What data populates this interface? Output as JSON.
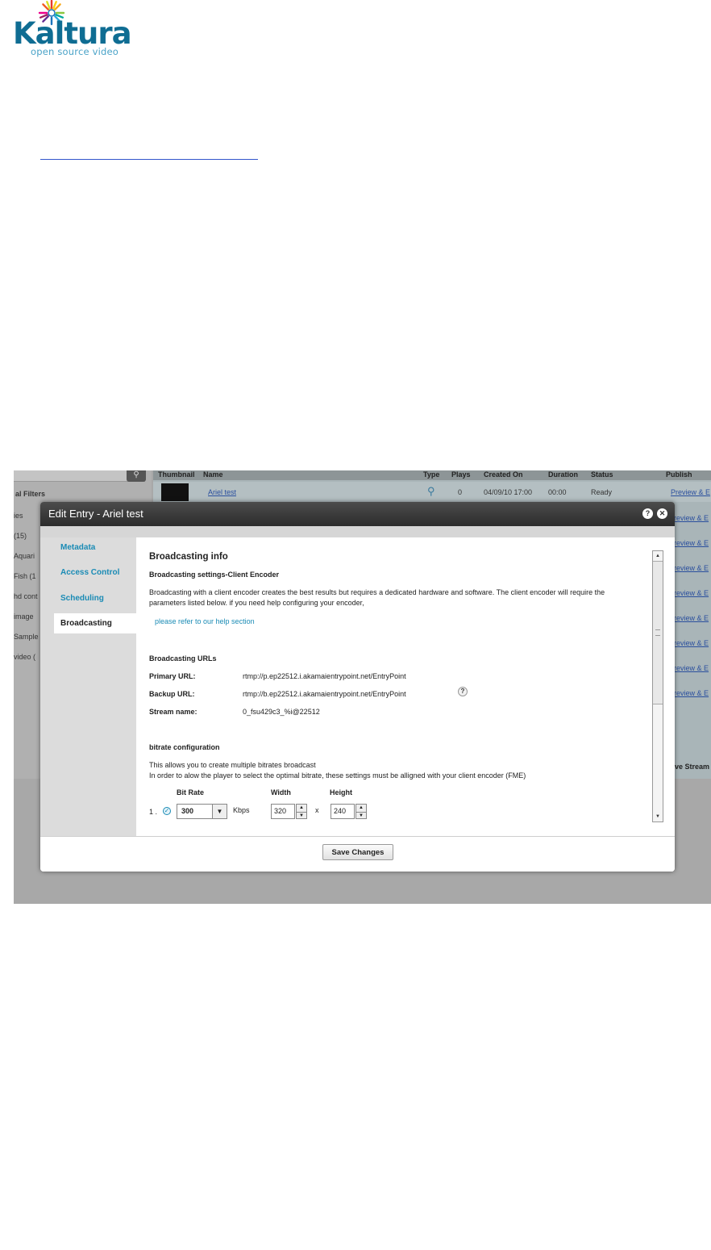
{
  "logo": {
    "word": "Kaltura",
    "tagline": "open source video"
  },
  "background_app": {
    "search_icon": "magnifier-icon",
    "filters_label": "al Filters",
    "tree_items": [
      "ies",
      "(15)",
      "Aquari",
      "Fish  (1",
      "hd cont",
      "image",
      "Sample",
      "video  ("
    ],
    "table_headers": [
      "Thumbnail",
      "Name",
      "Type",
      "Plays",
      "Created On",
      "Duration",
      "Status",
      "Publish"
    ],
    "row": {
      "name": "Ariel test",
      "plays": "0",
      "created": "04/09/10 17:00",
      "duration": "00:00",
      "status": "Ready",
      "publish": "Preview & E"
    },
    "publish_links": [
      "Preview & E",
      "Preview & E",
      "Preview & E",
      "Preview & E",
      "Preview & E",
      "Preview & E",
      "Preview & E",
      "Preview & E"
    ],
    "stream_button": "ve Stream"
  },
  "modal": {
    "title": "Edit Entry - Ariel test",
    "help_icon": "help-icon",
    "close_icon": "close-icon",
    "nav": [
      "Metadata",
      "Access Control",
      "Scheduling",
      "Broadcasting"
    ],
    "active_tab": "Broadcasting",
    "content": {
      "heading": "Broadcasting info",
      "subheading": "Broadcasting settings-Client Encoder",
      "intro_line1": "Broadcasting with a client encoder creates the best results but requires a dedicated hardware and software. The client encoder will require the",
      "intro_line2": "parameters listed below. if you need help configuring your encoder,",
      "help_link": "please refer to our help section",
      "urls_heading": "Broadcasting URLs",
      "primary_label": "Primary URL:",
      "primary_value": "rtmp://p.ep22512.i.akamaientrypoint.net/EntryPoint",
      "backup_label": "Backup URL:",
      "backup_value": "rtmp://b.ep22512.i.akamaientrypoint.net/EntryPoint",
      "stream_label": "Stream name:",
      "stream_value": "0_fsu429c3_%i@22512",
      "bitrate_heading": "bitrate configuration",
      "bitrate_line1": "This allows you to create multiple bitrates broadcast",
      "bitrate_line2": "In order to alow the player to select the optimal bitrate, these settings must be alligned with your client encoder (FME)",
      "col_bitrate": "Bit Rate",
      "col_width": "Width",
      "col_height": "Height",
      "row_index": "1 .",
      "bitrate_value": "300",
      "unit": "Kbps",
      "width_value": "320",
      "times": "x",
      "height_value": "240"
    },
    "save_label": "Save Changes"
  }
}
